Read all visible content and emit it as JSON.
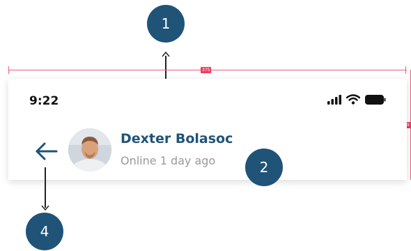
{
  "status_bar": {
    "time": "9:22",
    "icons": [
      "signal-icon",
      "wifi-icon",
      "battery-icon"
    ]
  },
  "header": {
    "back_icon": "arrow-left-icon",
    "contact": {
      "name": "Dexter Bolasoc",
      "status": "Online 1 day ago"
    }
  },
  "callouts": [
    "1",
    "2",
    "4"
  ],
  "measurements": {
    "width_label": "375",
    "height_label": "9"
  },
  "colors": {
    "primary": "#1f5377",
    "guide": "#ee5c7b",
    "muted_text": "#9a9a9a"
  }
}
